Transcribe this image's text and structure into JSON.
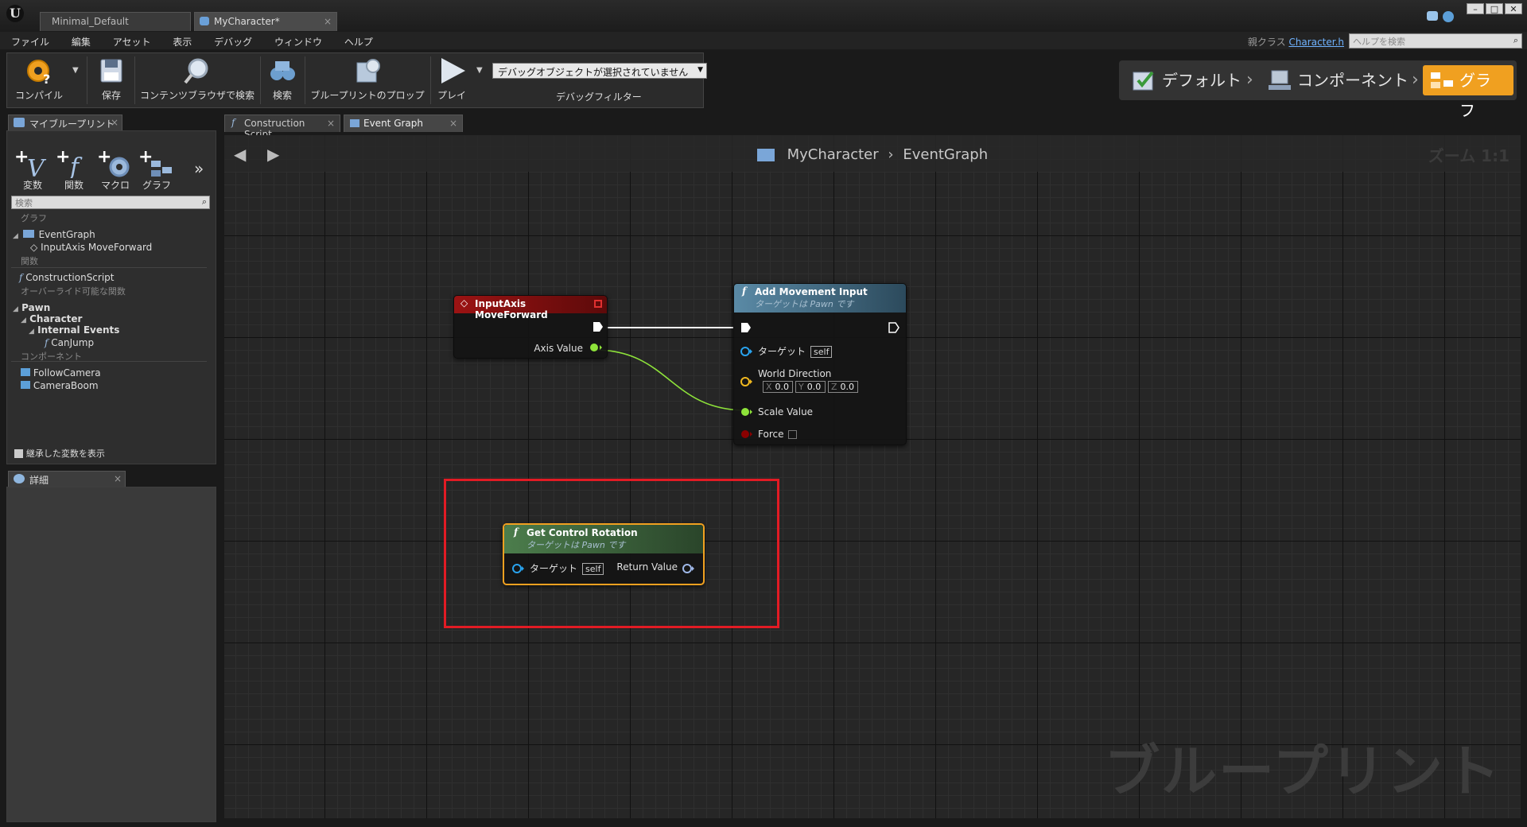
{
  "titlebar": {
    "tabs": [
      {
        "label": "Minimal_Default"
      },
      {
        "label": "MyCharacter*"
      }
    ],
    "win_controls": [
      "–",
      "□",
      "✕"
    ]
  },
  "menubar": {
    "items": [
      "ファイル",
      "編集",
      "アセット",
      "表示",
      "デバッグ",
      "ウィンドウ",
      "ヘルプ"
    ],
    "parent_class_label": "親クラス",
    "parent_class_link": "Character.h",
    "help_search_placeholder": "ヘルプを検索"
  },
  "toolbar": {
    "compile": "コンパイル",
    "save": "保存",
    "browse": "コンテンツブラウザで検索",
    "search": "検索",
    "defaults": "ブループリントのプロップ",
    "play": "プレイ",
    "debug_object": "デバッグオブジェクトが選択されていません",
    "debug_filter": "デバッグフィルター"
  },
  "modes": {
    "default": "デフォルト",
    "components": "コンポーネント",
    "graph": "グラフ"
  },
  "my_blueprint": {
    "tab_label": "マイブループリント",
    "add_variable": "変数",
    "add_function": "関数",
    "add_macro": "マクロ",
    "add_graph": "グラフ",
    "search_placeholder": "検索",
    "cat_graphs": "グラフ",
    "event_graph": "EventGraph",
    "input_axis": "InputAxis MoveForward",
    "cat_functions": "関数",
    "construction_script": "ConstructionScript",
    "cat_overridable": "オーバーライド可能な関数",
    "pawn": "Pawn",
    "character": "Character",
    "internal_events": "Internal Events",
    "can_jump": "CanJump",
    "cat_components": "コンポーネント",
    "follow_camera": "FollowCamera",
    "camera_boom": "CameraBoom",
    "show_inherited": "継承した変数を表示"
  },
  "details": {
    "tab_label": "詳細"
  },
  "graph_tabs": [
    {
      "label": "Construction Script"
    },
    {
      "label": "Event Graph"
    }
  ],
  "graph": {
    "breadcrumb_bp": "MyCharacter",
    "breadcrumb_graph": "EventGraph",
    "zoom": "ズーム 1:1",
    "watermark": "ブループリント"
  },
  "nodes": {
    "input_axis": {
      "title": "InputAxis MoveForward",
      "axis_value": "Axis Value"
    },
    "add_movement": {
      "title": "Add Movement Input",
      "subtitle": "ターゲットは Pawn です",
      "target": "ターゲット",
      "self": "self",
      "world_direction": "World Direction",
      "x_label": "X",
      "x": "0.0",
      "y_label": "Y",
      "y": "0.0",
      "z_label": "Z",
      "z": "0.0",
      "scale_value": "Scale Value",
      "force": "Force"
    },
    "get_control_rotation": {
      "title": "Get Control Rotation",
      "subtitle": "ターゲットは Pawn です",
      "target": "ターゲット",
      "self": "self",
      "return_value": "Return Value"
    }
  },
  "colors": {
    "event_header": "#8c1212",
    "function_header": "#4d7c96",
    "pure_header": "#3f6b3f",
    "float_pin": "#8ee33a",
    "object_pin": "#29a3ee",
    "vector_pin": "#f0b81f",
    "bool_pin": "#8a0000",
    "selection": "#f0a020",
    "highlight_box": "#e21b24"
  }
}
